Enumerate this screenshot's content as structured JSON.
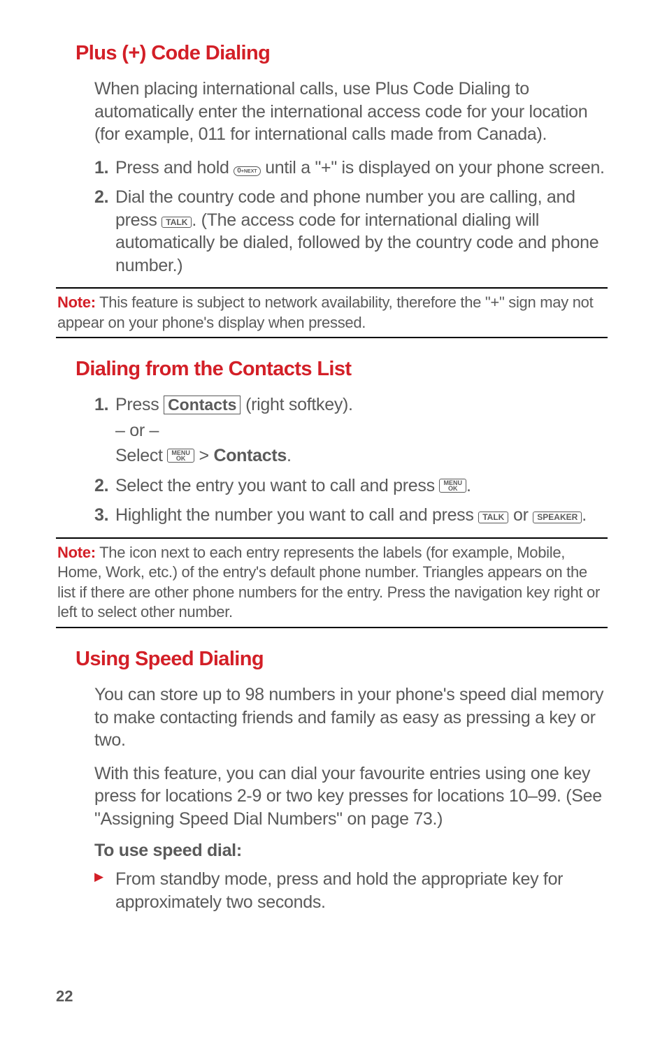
{
  "section1": {
    "heading": "Plus (+) Code Dialing",
    "intro": "When placing international calls, use Plus Code Dialing to automatically enter the international access code for your location (for example, 011 for international calls made from Canada).",
    "step1_a": "Press and hold ",
    "step1_b": " until a \"+\" is displayed on your phone screen.",
    "step2_a": "Dial the country code and phone number you are calling, and press ",
    "step2_b": ". (The access code for international dialing will automatically be dialed, followed by the country code and phone number.)",
    "key0": "0",
    "key0_sub": "+NEXT",
    "keyTalk": "TALK"
  },
  "note1": {
    "label": "Note:",
    "text": " This feature is subject to network availability, therefore the \"+\" sign may not appear on your phone's display when pressed."
  },
  "section2": {
    "heading": "Dialing from the Contacts List",
    "step1_a": "Press ",
    "contacts_softkey": "Contacts",
    "step1_b": " (right softkey).",
    "or": "– or –",
    "step1_c1": "Select ",
    "step1_c2": " > ",
    "step1_c3": "Contacts",
    "step1_c4": ".",
    "keyMenuTop": "MENU",
    "keyMenuBottom": "OK",
    "step2_a": "Select the entry you want to call and press ",
    "step2_b": ".",
    "step3_a": "Highlight the number you want to call and press ",
    "step3_b": " or ",
    "step3_c": ".",
    "keyTalk": "TALK",
    "keySpeaker": "SPEAKER"
  },
  "note2": {
    "label": "Note:",
    "text": " The icon next to each entry represents the labels (for example, Mobile, Home, Work, etc.) of the entry's default phone number. Triangles appears on the list if there are other phone numbers for the entry. Press the navigation key right or left to select other number."
  },
  "section3": {
    "heading": "Using Speed Dialing",
    "para1": "You can store up to 98 numbers in your phone's speed dial memory to make contacting friends and family as easy as pressing a key or two.",
    "para2": "With this feature, you can dial your favourite entries using one key press for locations 2-9 or two key presses for locations 10–99. (See \"Assigning Speed Dial Numbers\" on page 73.)",
    "subheading": "To use speed dial:",
    "bullet1": "From standby mode, press and hold the appropriate key for approximately two seconds."
  },
  "pageNumber": "22"
}
